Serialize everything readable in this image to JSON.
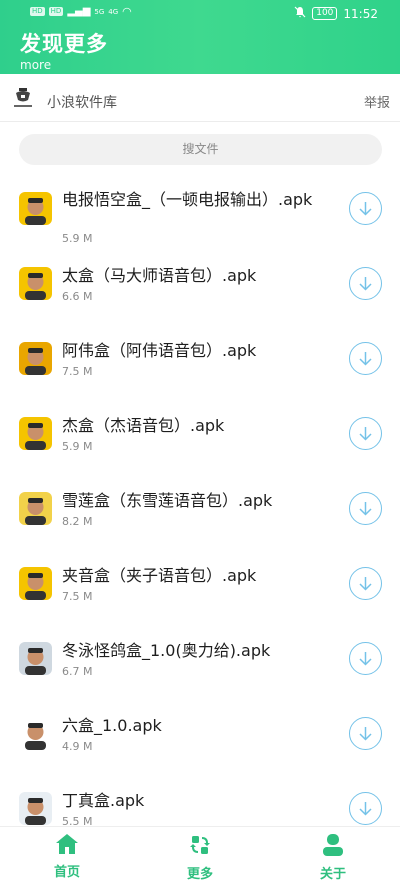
{
  "status": {
    "badge1": "HD",
    "badge2": "HD",
    "net1": "5G",
    "net2": "4G",
    "battery": "100",
    "time": "11:52"
  },
  "header": {
    "title": "发现更多",
    "subtitle": "more"
  },
  "store": {
    "name": "小浪软件库",
    "report": "举报"
  },
  "search": {
    "placeholder": "搜文件"
  },
  "files": [
    {
      "name": "电报悟空盒_（一顿电报输出）.apk",
      "size": "5.9 M"
    },
    {
      "name": "太盒（马大师语音包）.apk",
      "size": "6.6 M"
    },
    {
      "name": "阿伟盒（阿伟语音包）.apk",
      "size": "7.5 M"
    },
    {
      "name": "杰盒（杰语音包）.apk",
      "size": "5.9 M"
    },
    {
      "name": "雪莲盒（东雪莲语音包）.apk",
      "size": "8.2 M"
    },
    {
      "name": "夹音盒（夹子语音包）.apk",
      "size": "7.5 M"
    },
    {
      "name": "冬泳怪鸽盒_1.0(奥力给).apk",
      "size": "6.7 M"
    },
    {
      "name": "六盒_1.0.apk",
      "size": "4.9 M"
    },
    {
      "name": "丁真盒.apk",
      "size": "5.5 M"
    }
  ],
  "nav": {
    "home": "首页",
    "more": "更多",
    "about": "关于"
  },
  "colors": {
    "accent": "#2fcf8c",
    "download": "#74c2e8",
    "nav": "#2fbf7f"
  }
}
